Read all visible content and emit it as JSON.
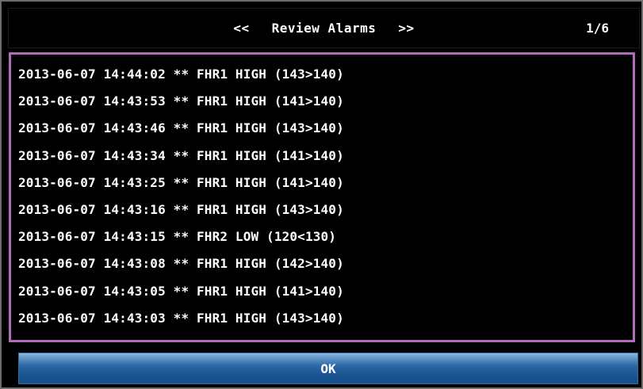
{
  "header": {
    "prev_label": "<<",
    "title": "Review Alarms",
    "next_label": ">>",
    "page_indicator": "1/6"
  },
  "alarms": [
    "2013-06-07 14:44:02 ** FHR1 HIGH (143>140)",
    "2013-06-07 14:43:53 ** FHR1 HIGH (141>140)",
    "2013-06-07 14:43:46 ** FHR1 HIGH (143>140)",
    "2013-06-07 14:43:34 ** FHR1 HIGH (141>140)",
    "2013-06-07 14:43:25 ** FHR1 HIGH (141>140)",
    "2013-06-07 14:43:16 ** FHR1 HIGH (143>140)",
    "2013-06-07 14:43:15 ** FHR2 LOW (120<130)",
    "2013-06-07 14:43:08 ** FHR1 HIGH (142>140)",
    "2013-06-07 14:43:05 ** FHR1 HIGH (141>140)",
    "2013-06-07 14:43:03 ** FHR1 HIGH (143>140)"
  ],
  "footer": {
    "ok_label": "OK"
  },
  "colors": {
    "background": "#000000",
    "list_border": "#b36ab8",
    "button_blue": "#1f5a99",
    "text": "#ffffff"
  }
}
